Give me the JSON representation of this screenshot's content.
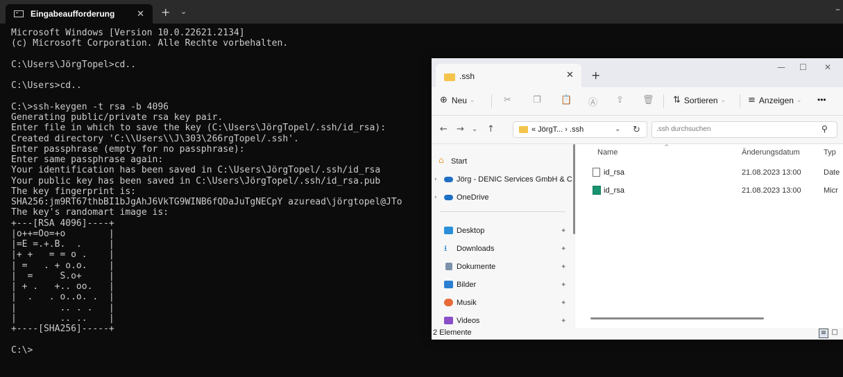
{
  "terminal": {
    "tab_title": "Eingabeaufforderung",
    "lines": [
      "Microsoft Windows [Version 10.0.22621.2134]",
      "(c) Microsoft Corporation. Alle Rechte vorbehalten.",
      "",
      "C:\\Users\\JörgTopel>cd..",
      "",
      "C:\\Users>cd..",
      "",
      "C:\\>ssh-keygen -t rsa -b 4096",
      "Generating public/private rsa key pair.",
      "Enter file in which to save the key (C:\\Users\\JörgTopel/.ssh/id_rsa):",
      "Created directory 'C:\\\\Users\\\\J\\303\\266rgTopel/.ssh'.",
      "Enter passphrase (empty for no passphrase):",
      "Enter same passphrase again:",
      "Your identification has been saved in C:\\Users\\JörgTopel/.ssh/id_rsa",
      "Your public key has been saved in C:\\Users\\JörgTopel/.ssh/id_rsa.pub",
      "The key fingerprint is:",
      "SHA256:jm9RT67thbBI1bJgAhJ6VkTG9WINB6fQDaJuTgNECpY azuread\\jörgtopel@JTo",
      "The key's randomart image is:",
      "+---[RSA 4096]----+",
      "|o++=Oo=+o        |",
      "|=E =.+.B.  .     |",
      "|+ +   = = o .    |",
      "| =   . + o.o.    |",
      "|  =     S.o+     |",
      "| + .   +.. oo.   |",
      "|  .   . o..o. .  |",
      "|        .. . .   |",
      "|        .. ..    |",
      "+----[SHA256]-----+",
      "",
      "C:\\>"
    ]
  },
  "explorer": {
    "tab_title": ".ssh",
    "toolbar": {
      "new_label": "Neu",
      "sort_label": "Sortieren",
      "view_label": "Anzeigen",
      "more_label": "•••"
    },
    "address": {
      "path": "« JörgT... › .ssh",
      "search_placeholder": ".ssh durchsuchen"
    },
    "nav": {
      "start": "Start",
      "cloud_org": "Jörg - DENIC Services GmbH & C",
      "onedrive": "OneDrive",
      "quick": [
        "Desktop",
        "Downloads",
        "Dokumente",
        "Bilder",
        "Musik",
        "Videos"
      ]
    },
    "columns": {
      "name": "Name",
      "date": "Änderungsdatum",
      "type": "Typ"
    },
    "files": [
      {
        "name": "id_rsa",
        "date": "21.08.2023 13:00",
        "type": "Date",
        "icon": "file-icon"
      },
      {
        "name": "id_rsa",
        "date": "21.08.2023 13:00",
        "type": "Micr",
        "icon": "publisher-file-icon"
      }
    ],
    "status": "2 Elemente"
  }
}
